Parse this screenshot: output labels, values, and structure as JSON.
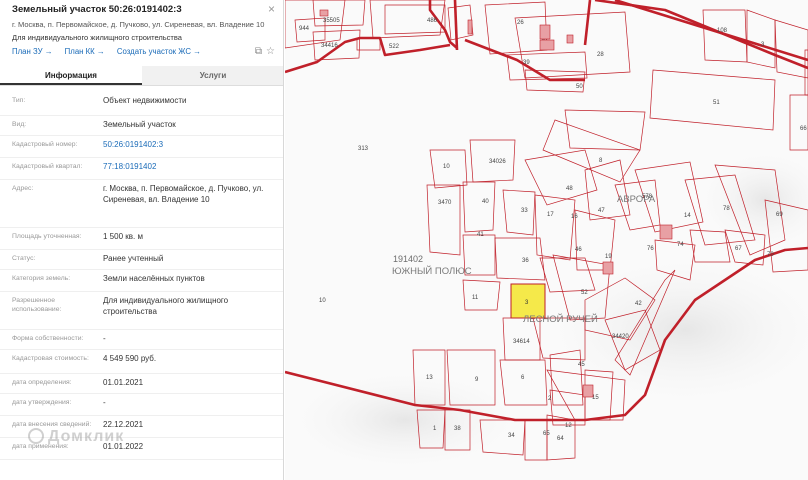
{
  "panel": {
    "title": "Земельный участок 50:26:0191402:3",
    "address_line": "г. Москва, п. Первомайское, д. Пучково, ул. Сиреневая, вл. Владение 10",
    "purpose_line": "Для индивидуального жилищного строительства",
    "links": [
      "План ЗУ →",
      "План КК →",
      "Создать участок ЖС →"
    ],
    "tabs": [
      "Информация",
      "Услуги"
    ],
    "rows": [
      {
        "k": "Тип:",
        "v": "Объект недвижимости"
      },
      {
        "k": "Вид:",
        "v": "Земельный участок"
      },
      {
        "k": "Кадастровый номер:",
        "v": "50:26:0191402:3"
      },
      {
        "k": "Кадастровый квартал:",
        "v": "77:18:0191402"
      },
      {
        "k": "Адрес:",
        "v": "г. Москва, п. Первомайское, д. Пучково, ул. Сиреневая, вл. Владение 10"
      },
      {
        "k": "Площадь уточненная:",
        "v": "1 500 кв. м"
      },
      {
        "k": "Статус:",
        "v": "Ранее учтенный"
      },
      {
        "k": "Категория земель:",
        "v": "Земли населённых пунктов"
      },
      {
        "k": "Разрешенное использование:",
        "v": "Для индивидуального жилищного строительства"
      },
      {
        "k": "Форма собственности:",
        "v": "-"
      },
      {
        "k": "Кадастровая стоимость:",
        "v": "4 549 590 руб."
      },
      {
        "k": "дата определения:",
        "v": "01.01.2021"
      },
      {
        "k": "дата утверждения:",
        "v": "-"
      },
      {
        "k": "дата внесения сведений:",
        "v": "22.12.2021"
      },
      {
        "k": "дата применения:",
        "v": "01.01.2022"
      }
    ],
    "watermark": "Домклик"
  },
  "map": {
    "labels": {
      "quarter": "191402",
      "yuzhny": "ЮЖНЫЙ ПОЛЮС",
      "lesnoy": "ЛЕСНОЙ РУЧЕЙ",
      "avrora": "АВРОРА",
      "selected": "3"
    },
    "parcels": [
      "35505",
      "486",
      "26",
      "27",
      "28",
      "108",
      "3",
      "944",
      "34416",
      "522",
      "39",
      "50",
      "51",
      "66",
      "313",
      "10",
      "34026",
      "8",
      "48",
      "47",
      "578",
      "14",
      "78",
      "69",
      "3470",
      "40",
      "33",
      "17",
      "16",
      "74",
      "76",
      "67",
      "70",
      "41",
      "36",
      "46",
      "19",
      "52",
      "42",
      "11",
      "34614",
      "34420",
      "45",
      "13",
      "9",
      "6",
      "2",
      "15",
      "1",
      "38",
      "34",
      "65",
      "64",
      "12",
      "10"
    ],
    "colors": {
      "border": "#c0202a",
      "selected": "#f5e94a"
    }
  }
}
